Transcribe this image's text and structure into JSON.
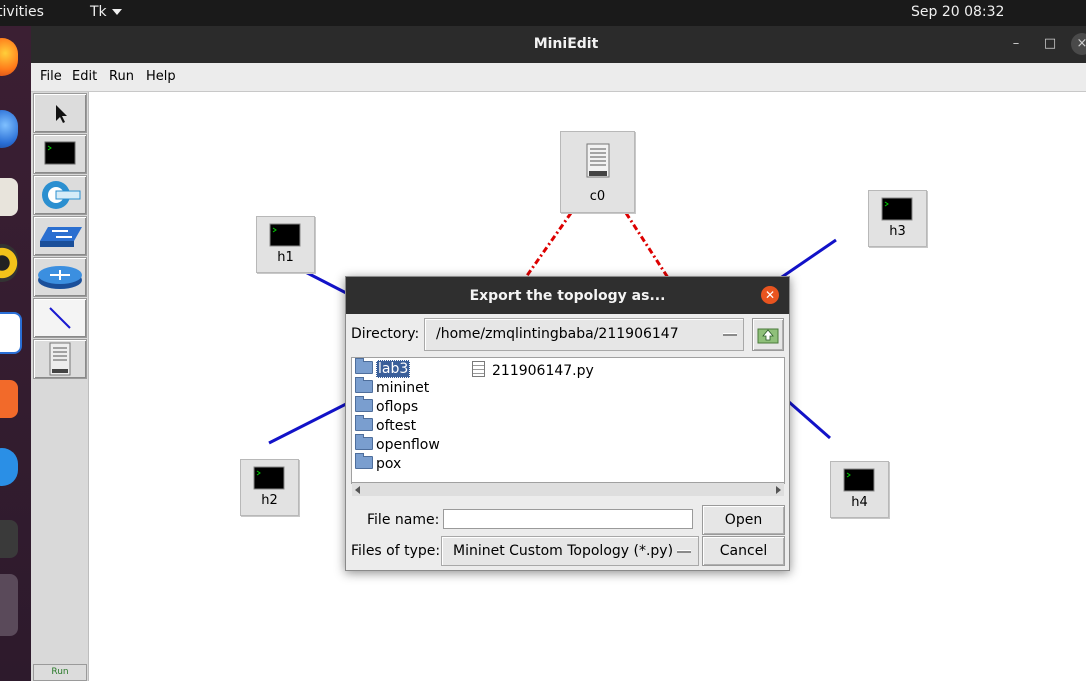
{
  "topbar": {
    "activities": "Activities",
    "app_menu": "Tk",
    "clock": "Sep 20  08:32"
  },
  "window": {
    "title": "MiniEdit",
    "controls": {
      "minimize": "–",
      "maximize": "□",
      "close": "×"
    },
    "menus": [
      "File",
      "Edit",
      "Run",
      "Help"
    ]
  },
  "toolbox": {
    "tools": [
      "select-tool",
      "host-tool",
      "controller-tool",
      "switch-tool",
      "router-tool",
      "link-tool",
      "server-tool"
    ],
    "run_label": "Run"
  },
  "canvas": {
    "nodes": [
      {
        "id": "c0",
        "label": "c0",
        "kind": "controller"
      },
      {
        "id": "h1",
        "label": "h1",
        "kind": "host"
      },
      {
        "id": "h2",
        "label": "h2",
        "kind": "host"
      },
      {
        "id": "h3",
        "label": "h3",
        "kind": "host"
      },
      {
        "id": "h4",
        "label": "h4",
        "kind": "host"
      }
    ],
    "link_colors": {
      "data": "#1212c8",
      "control": "#dd0000"
    }
  },
  "dialog": {
    "title": "Export the topology as...",
    "directory_label": "Directory:",
    "directory_value": "/home/zmqlintingbaba/211906147",
    "folders": [
      "lab3",
      "mininet",
      "oflops",
      "oftest",
      "openflow",
      "pox"
    ],
    "files": [
      "211906147.py"
    ],
    "selected": "lab3",
    "filename_label": "File name:",
    "filename_value": "",
    "filetype_label": "Files of type:",
    "filetype_value": "Mininet Custom Topology (*.py)",
    "open_label": "Open",
    "cancel_label": "Cancel",
    "close_color": "#e9541f"
  }
}
